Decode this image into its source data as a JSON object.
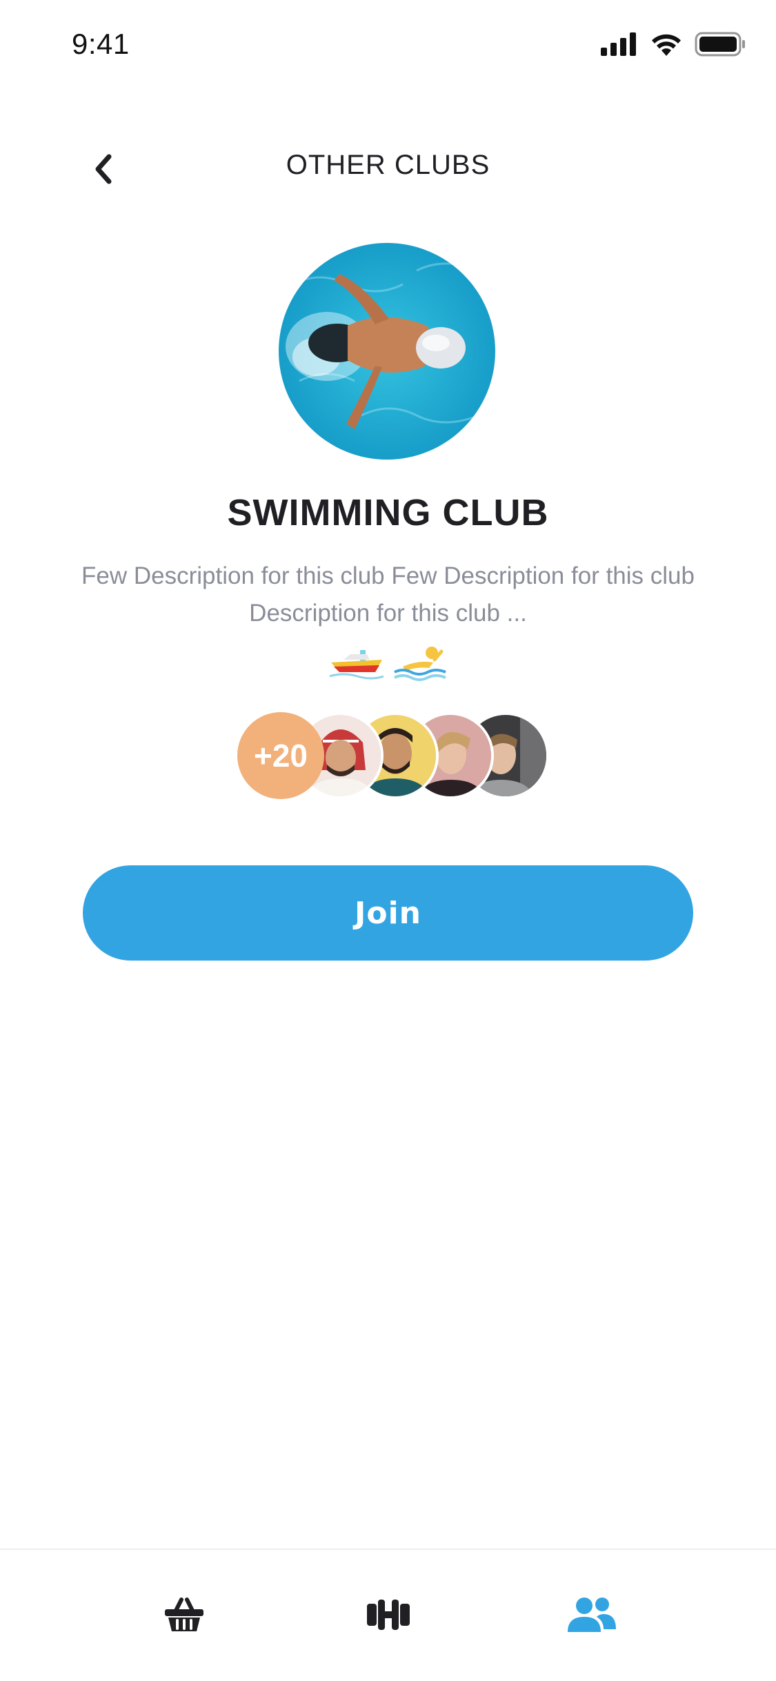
{
  "status_bar": {
    "time": "9:41"
  },
  "header": {
    "title": "OTHER CLUBS"
  },
  "club": {
    "name": "SWIMMING CLUB",
    "description": "Few Description for this club Few Description for this club Description for this club ...",
    "emojis": [
      "speedboat-icon",
      "person-swimming-icon"
    ]
  },
  "members": {
    "more_count_label": "+20"
  },
  "actions": {
    "join_label": "Join"
  },
  "tab_bar": {
    "items": [
      "shop-basket-icon",
      "dumbbell-icon",
      "people-icon"
    ],
    "active_color": "#33a4e2",
    "inactive_color": "#1f1f24"
  },
  "colors": {
    "accent": "#33a4e2",
    "badge": "#f2b07a",
    "muted_text": "#8a8d98"
  }
}
